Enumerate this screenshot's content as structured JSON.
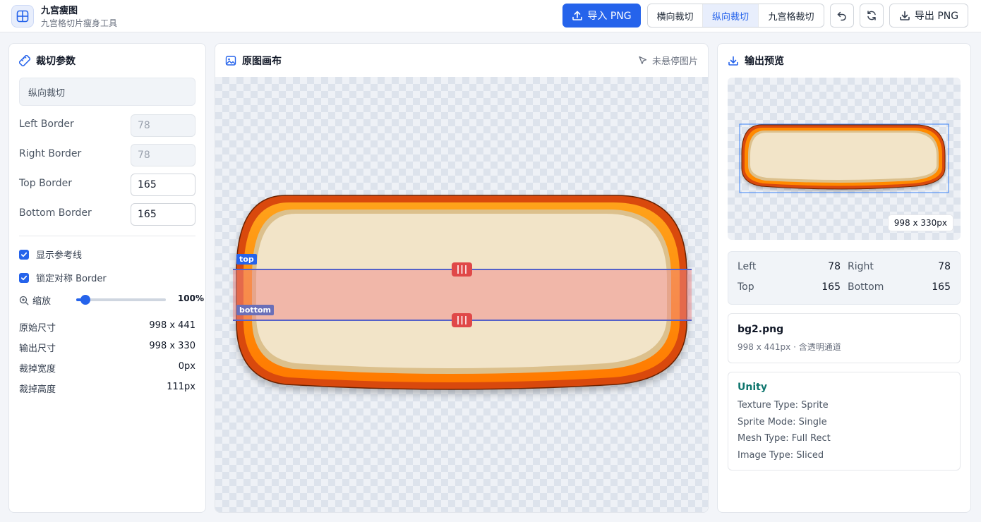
{
  "header": {
    "app_title": "九宫瘦图",
    "app_subtitle": "九宫格切片瘦身工具",
    "import_label": "导入 PNG",
    "modes": [
      {
        "label": "横向裁切",
        "active": false
      },
      {
        "label": "纵向裁切",
        "active": true
      },
      {
        "label": "九宫格裁切",
        "active": false
      }
    ],
    "export_label": "导出 PNG"
  },
  "params": {
    "title": "裁切参数",
    "mode_display": "纵向裁切",
    "fields": [
      {
        "label": "Left Border",
        "value": "78",
        "disabled": true
      },
      {
        "label": "Right Border",
        "value": "78",
        "disabled": true
      },
      {
        "label": "Top Border",
        "value": "165",
        "disabled": false
      },
      {
        "label": "Bottom Border",
        "value": "165",
        "disabled": false
      }
    ],
    "show_guides_label": "显示参考线",
    "show_guides": true,
    "lock_symmetric_label": "锁定对称 Border",
    "lock_symmetric": true,
    "zoom_label": "缩放",
    "zoom_value": "100%",
    "zoom_fraction": 0.1,
    "stats": [
      {
        "label": "原始尺寸",
        "value": "998 x 441"
      },
      {
        "label": "输出尺寸",
        "value": "998 x 330"
      },
      {
        "label": "裁掉宽度",
        "value": "0px"
      },
      {
        "label": "裁掉高度",
        "value": "111px"
      }
    ]
  },
  "canvas": {
    "title": "原图画布",
    "hover_hint": "未悬停图片",
    "top_tag": "top",
    "bottom_tag": "bottom"
  },
  "preview": {
    "title": "输出预览",
    "size_badge": "998 x 330px",
    "borders": {
      "left_label": "Left",
      "left_value": "78",
      "right_label": "Right",
      "right_value": "78",
      "top_label": "Top",
      "top_value": "165",
      "bottom_label": "Bottom",
      "bottom_value": "165"
    },
    "file_name": "bg2.png",
    "file_meta": "998 x 441px · 含透明通道",
    "unity": {
      "title": "Unity",
      "lines": [
        "Texture Type: Sprite",
        "Sprite Mode: Single",
        "Mesh Type: Full Rect",
        "Image Type: Sliced"
      ]
    }
  },
  "colors": {
    "accent": "#2563eb",
    "slice_band": "#ef8a8a",
    "frame_orange": "#ff8a00",
    "frame_dark": "#8a3a00",
    "panel_fill": "#f2e4c8",
    "unity_title": "#0f766e"
  },
  "icons": {
    "logo": "grid-icon",
    "import": "upload-icon",
    "undo": "undo-icon",
    "reset": "refresh-icon",
    "export": "download-icon",
    "params": "ruler-icon",
    "canvas": "image-icon",
    "pointer": "cursor-icon",
    "preview": "download-icon",
    "zoom": "zoom-in-icon",
    "handle": "drag-handle-icon"
  }
}
